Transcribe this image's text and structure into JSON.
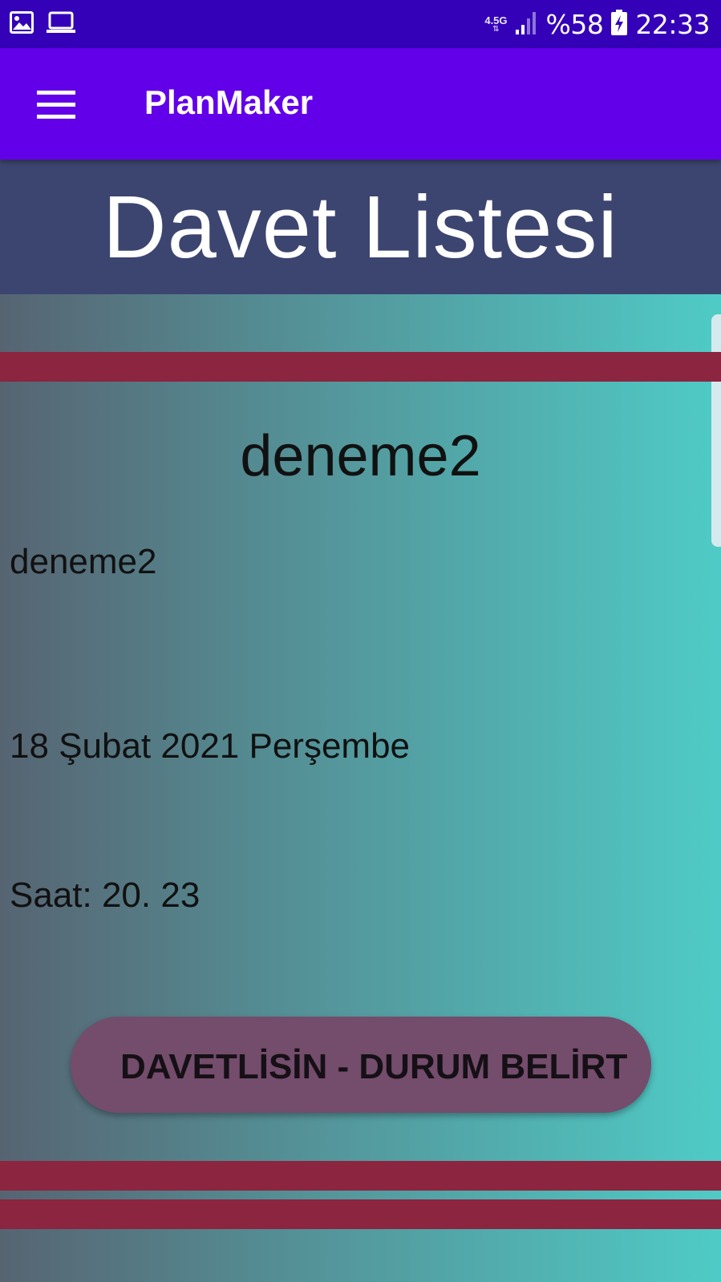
{
  "status_bar": {
    "network_type": "4.5G",
    "network_arrows": "⇅",
    "battery_percent": "%58",
    "time": "22:33",
    "icons": [
      "image-icon",
      "laptop-icon",
      "signal-icon",
      "battery-charging-icon"
    ]
  },
  "app_bar": {
    "title": "PlanMaker",
    "menu_icon": "hamburger-menu-icon"
  },
  "header": {
    "title": "Davet Listesi"
  },
  "invite": {
    "title": "deneme2",
    "description": "deneme2",
    "date": "18 Şubat 2021 Perşembe",
    "time": "Saat: 20. 23",
    "action_label": "DAVETLİSİN - DURUM BELİRT"
  },
  "colors": {
    "status_bar": "#3400b8",
    "app_bar": "#6200ea",
    "header_band": "#3c4570",
    "divider": "#8b2540",
    "button": "#744c6c"
  }
}
